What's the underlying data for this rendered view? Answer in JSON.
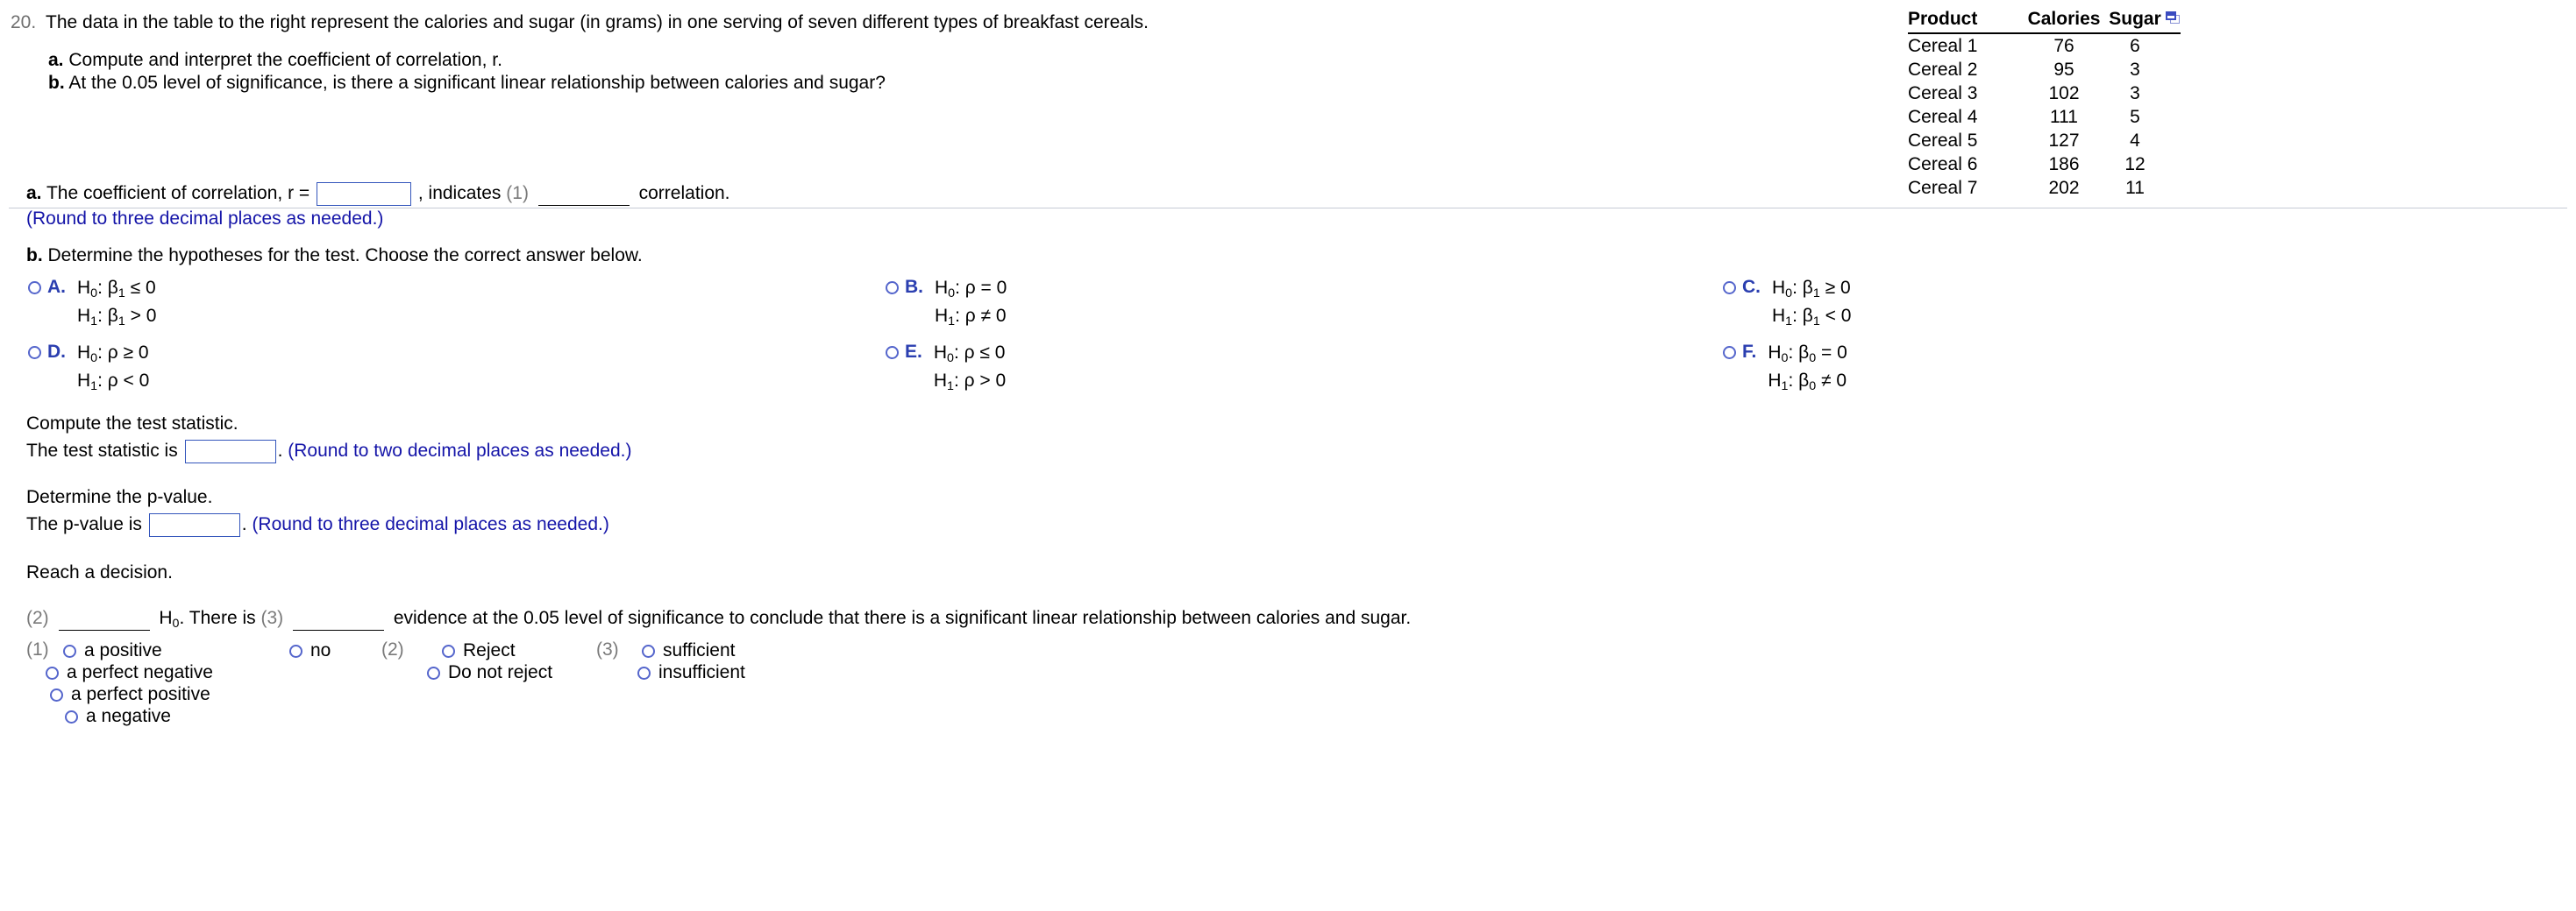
{
  "question": {
    "number": "20.",
    "stem": "The data in the table to the right represent the calories and sugar (in grams) in one serving of seven different types of breakfast cereals.",
    "part_a_label": "a.",
    "part_a_text": "Compute and interpret the coefficient of correlation, r.",
    "part_b_label": "b.",
    "part_b_text": "At the 0.05 level of significance, is there a significant linear relationship between calories and sugar?"
  },
  "table": {
    "headers": [
      "Product",
      "Calories",
      "Sugar"
    ],
    "rows": [
      {
        "product": "Cereal 1",
        "calories": "76",
        "sugar": "6"
      },
      {
        "product": "Cereal 2",
        "calories": "95",
        "sugar": "3"
      },
      {
        "product": "Cereal 3",
        "calories": "102",
        "sugar": "3"
      },
      {
        "product": "Cereal 4",
        "calories": "111",
        "sugar": "5"
      },
      {
        "product": "Cereal 5",
        "calories": "127",
        "sugar": "4"
      },
      {
        "product": "Cereal 6",
        "calories": "186",
        "sugar": "12"
      },
      {
        "product": "Cereal 7",
        "calories": "202",
        "sugar": "11"
      }
    ],
    "copy_icon": "copy-to-spreadsheet-icon"
  },
  "answer": {
    "a_label": "a.",
    "a_prefix": "The coefficient of correlation, r =",
    "a_mid": ", indicates",
    "a_ref": "(1)",
    "a_suffix": "correlation.",
    "a_round_note": "(Round to three decimal places as needed.)",
    "r_value": "",
    "b_label": "b.",
    "b_text": "Determine the hypotheses for the test. Choose the correct answer below.",
    "options": [
      {
        "letter": "A.",
        "h0": "H<sub>0</sub>: β<sub>1</sub> ≤ 0",
        "h1": "H<sub>1</sub>: β<sub>1</sub> > 0"
      },
      {
        "letter": "B.",
        "h0": "H<sub>0</sub>: ρ = 0",
        "h1": "H<sub>1</sub>: ρ ≠ 0"
      },
      {
        "letter": "C.",
        "h0": "H<sub>0</sub>: β<sub>1</sub> ≥ 0",
        "h1": "H<sub>1</sub>: β<sub>1</sub> < 0"
      },
      {
        "letter": "D.",
        "h0": "H<sub>0</sub>: ρ ≥ 0",
        "h1": "H<sub>1</sub>: ρ < 0"
      },
      {
        "letter": "E.",
        "h0": "H<sub>0</sub>: ρ ≤ 0",
        "h1": "H<sub>1</sub>: ρ > 0"
      },
      {
        "letter": "F.",
        "h0": "H<sub>0</sub>: β<sub>0</sub> = 0",
        "h1": "H<sub>1</sub>: β<sub>0</sub> ≠ 0"
      }
    ],
    "compute_ts_heading": "Compute the test statistic.",
    "ts_prefix": "The test statistic is",
    "ts_value": "",
    "ts_suffix": ".",
    "ts_round_note": "(Round to two decimal places as needed.)",
    "determine_pv_heading": "Determine the p-value.",
    "pv_prefix": "The p-value is",
    "pv_value": "",
    "pv_suffix": ".",
    "pv_round_note": "(Round to three decimal places as needed.)",
    "decision_heading": "Reach a decision.",
    "conclusion_ref2": "(2)",
    "conclusion_mid1": "H<sub>0</sub>. There is",
    "conclusion_ref3": "(3)",
    "conclusion_tail": "evidence at the 0.05 level of significance to conclude that there is a significant linear relationship between calories and sugar."
  },
  "dropdown_groups": {
    "g1_ref": "(1)",
    "g1_colA": [
      "a positive",
      "a perfect negative",
      "a perfect positive",
      "a negative"
    ],
    "g1_colB": [
      "no"
    ],
    "g2_ref": "(2)",
    "g2": [
      "Reject",
      "Do not reject"
    ],
    "g3_ref": "(3)",
    "g3": [
      "sufficient",
      "insufficient"
    ]
  },
  "colors": {
    "blue_note": "#1414a8",
    "radio_blue": "#5566cc",
    "letter_blue": "#2b3fb0",
    "input_border": "#3355bb",
    "ref_gray": "#7a7a7a",
    "divider": "#c6cbd4"
  }
}
